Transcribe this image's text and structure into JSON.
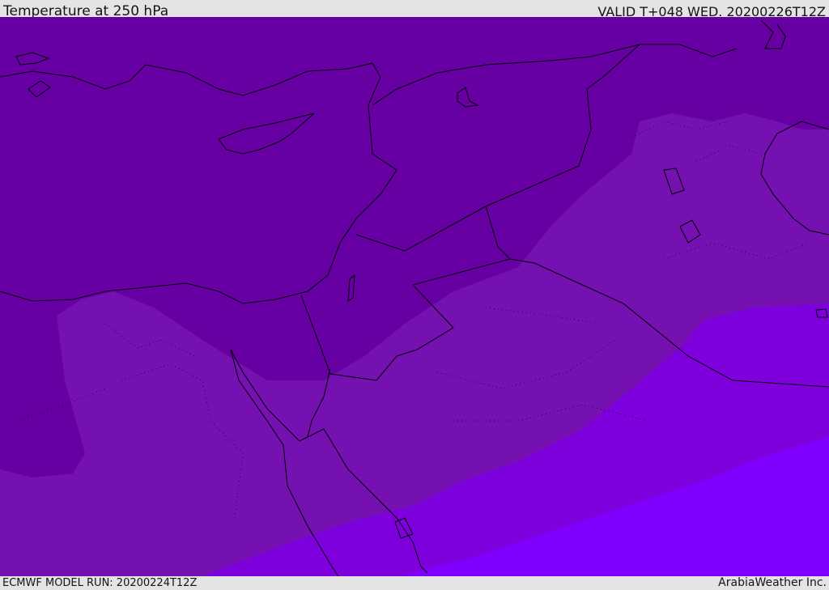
{
  "header": {
    "title": "Temperature at 250 hPa",
    "valid": "VALID T+048 WED. 20200226T12Z"
  },
  "footer": {
    "model_run": "ECMWF MODEL RUN: 20200224T12Z",
    "credit": "ArabiaWeather Inc."
  },
  "map": {
    "field": "temperature_250hPa",
    "region": "Eastern Mediterranean / Levant / Arabian Peninsula",
    "colors": {
      "band_darkest": "#5f0091",
      "band_dark": "#6600a3",
      "band_mid": "#7511b0",
      "band_light": "#7d00dd",
      "band_lightest": "#8000ff",
      "coastline": "#000000",
      "borders": "#000000"
    }
  }
}
